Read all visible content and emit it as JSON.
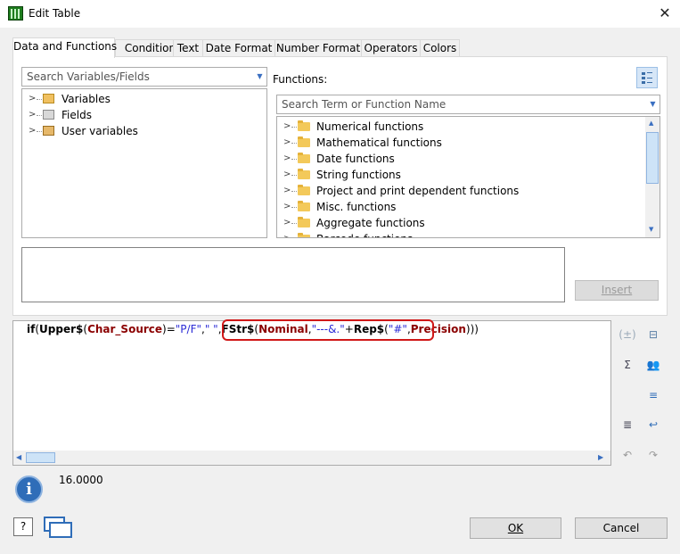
{
  "window": {
    "title": "Edit Table",
    "close_glyph": "✕"
  },
  "tabs": [
    "Data and Functions",
    "Condition",
    "Text",
    "Date Format",
    "Number Format",
    "Operators",
    "Colors"
  ],
  "left_panel": {
    "search_placeholder": "Search Variables/Fields",
    "items": [
      {
        "label": "Variables",
        "icon": "variables-icon"
      },
      {
        "label": "Fields",
        "icon": "fields-icon"
      },
      {
        "label": "User variables",
        "icon": "user-variables-icon"
      }
    ]
  },
  "functions_panel": {
    "label": "Functions:",
    "search_placeholder": "Search Term or Function Name",
    "items": [
      "Numerical functions",
      "Mathematical functions",
      "Date functions",
      "String functions",
      "Project and print dependent functions",
      "Misc. functions",
      "Aggregate functions",
      "Barcode functions"
    ]
  },
  "insert_button": "Insert",
  "expression": {
    "tokens": [
      {
        "t": "if",
        "c": "k"
      },
      {
        "t": "(",
        "c": "p"
      },
      {
        "t": "Upper$",
        "c": "k"
      },
      {
        "t": "(",
        "c": "p"
      },
      {
        "t": "Char_Source",
        "c": "dr"
      },
      {
        "t": ")=",
        "c": "p"
      },
      {
        "t": "\"P/F\"",
        "c": "st"
      },
      {
        "t": ",",
        "c": "p"
      },
      {
        "t": "\" \"",
        "c": "st"
      },
      {
        "t": ",",
        "c": "p"
      },
      {
        "t": "FStr$",
        "c": "k"
      },
      {
        "t": "(",
        "c": "p"
      },
      {
        "t": "Nominal",
        "c": "dr"
      },
      {
        "t": ",",
        "c": "p"
      },
      {
        "t": "\"---&.\"",
        "c": "st"
      },
      {
        "t": "+",
        "c": "p"
      },
      {
        "t": "Rep$",
        "c": "k"
      },
      {
        "t": "(",
        "c": "p"
      },
      {
        "t": "\"#\"",
        "c": "st"
      },
      {
        "t": ",",
        "c": "p"
      },
      {
        "t": "Precision",
        "c": "dr"
      },
      {
        "t": ")))",
        "c": "p"
      }
    ]
  },
  "result": {
    "value": "16.0000",
    "icon": "info-icon"
  },
  "footer": {
    "ok": "OK",
    "cancel": "Cancel"
  },
  "side_tools": [
    "brackets-icon",
    "field-icon",
    "sum-icon",
    "users-icon",
    "indent-icon",
    "wrap-icon",
    "line-break-icon",
    "undo-icon",
    "redo-icon"
  ]
}
